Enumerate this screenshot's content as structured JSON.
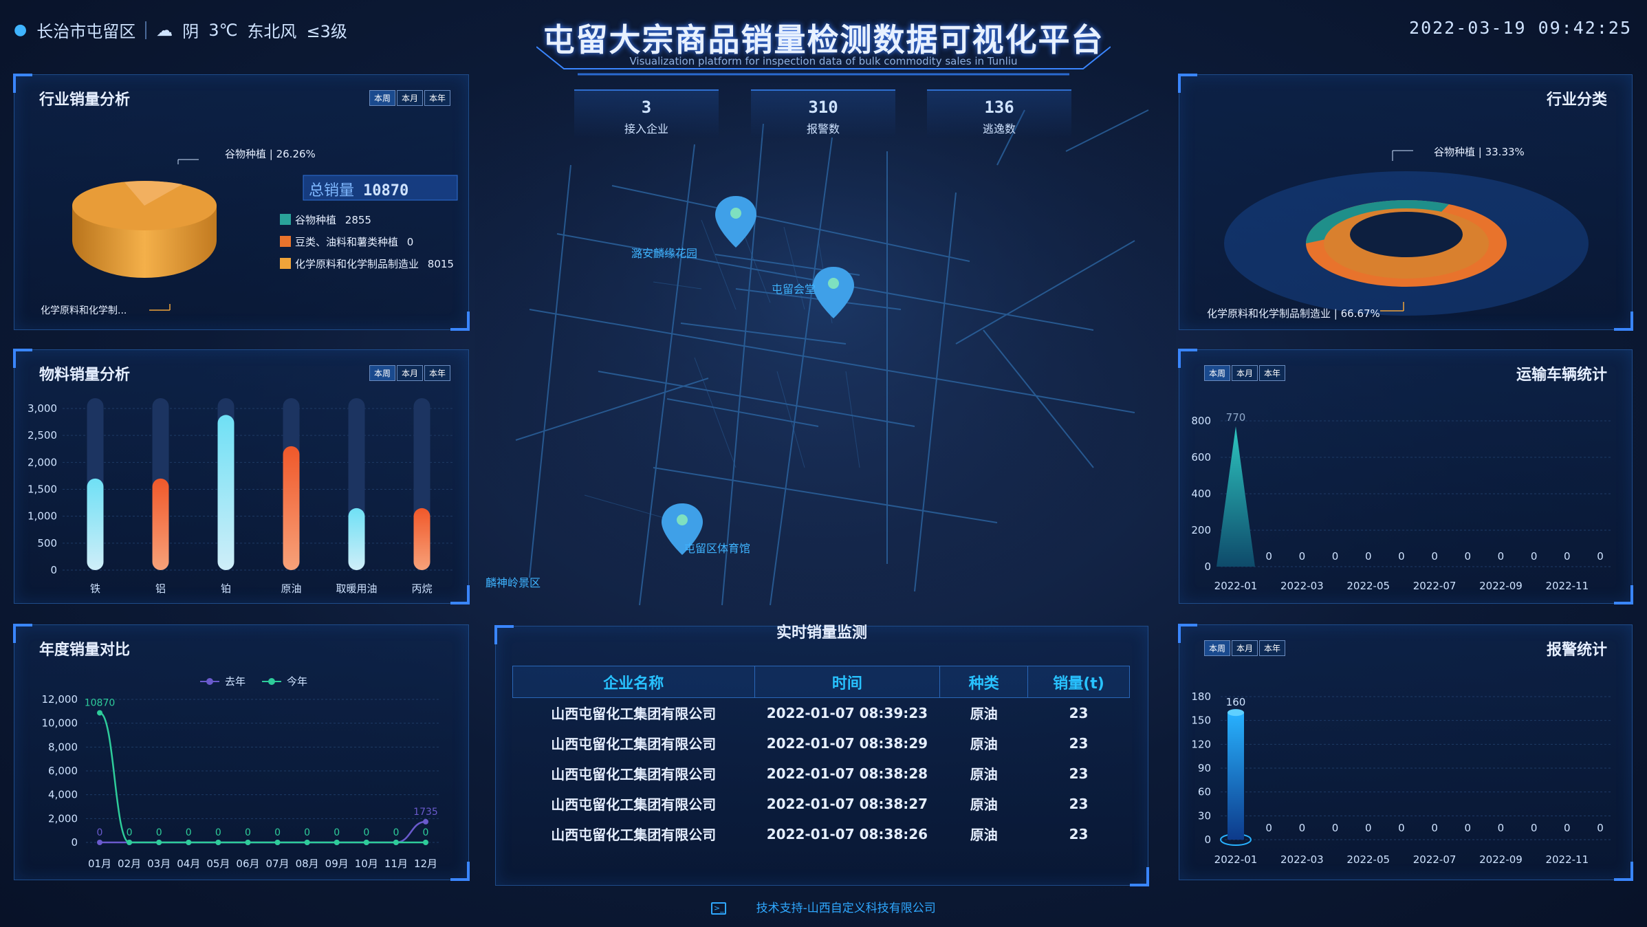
{
  "header": {
    "location": "长治市屯留区",
    "weather": "阴",
    "temperature": "3℃",
    "wind": "东北风",
    "wind_level": "≤3级",
    "title": "屯留大宗商品销量检测数据可视化平台",
    "subtitle": "Visualization platform for inspection data of bulk commodity sales in Tunliu",
    "datetime": "2022-03-19 09:42:25"
  },
  "tabs": [
    "本周",
    "本月",
    "本年"
  ],
  "stats": [
    {
      "value": "3",
      "label": "接入企业"
    },
    {
      "value": "310",
      "label": "报警数"
    },
    {
      "value": "136",
      "label": "逃逸数"
    }
  ],
  "map": {
    "places": [
      "潞安麟缘花园",
      "屯留会堂",
      "屯留区体育馆",
      "麟神岭景区"
    ]
  },
  "industry_sales": {
    "title": "行业销量分析",
    "total_label": "总销量",
    "total_value": "10870",
    "top_label": "谷物种植 | 26.26%",
    "bottom_label": "化学原料和化学制...",
    "legend": [
      {
        "name": "谷物种植",
        "value": "2855",
        "color": "#2aa39a"
      },
      {
        "name": "豆类、油料和薯类种植",
        "value": "0",
        "color": "#e8732c"
      },
      {
        "name": "化学原料和化学制品制造业",
        "value": "8015",
        "color": "#f0a43a"
      }
    ]
  },
  "industry_class": {
    "title": "行业分类",
    "top_label": "谷物种植 | 33.33%",
    "bottom_label": "化学原料和化学制品制造业 | 66.67%"
  },
  "material": {
    "title": "物料销量分析"
  },
  "transport": {
    "title": "运输车辆统计"
  },
  "annual": {
    "title": "年度销量对比"
  },
  "alarm": {
    "title": "报警统计"
  },
  "monitor": {
    "title": "实时销量监测",
    "columns": [
      "企业名称",
      "时间",
      "种类",
      "销量(t)"
    ],
    "rows": [
      [
        "山西屯留化工集团有限公司",
        "2022-01-07 08:39:23",
        "原油",
        "23"
      ],
      [
        "山西屯留化工集团有限公司",
        "2022-01-07 08:38:29",
        "原油",
        "23"
      ],
      [
        "山西屯留化工集团有限公司",
        "2022-01-07 08:38:28",
        "原油",
        "23"
      ],
      [
        "山西屯留化工集团有限公司",
        "2022-01-07 08:38:27",
        "原油",
        "23"
      ],
      [
        "山西屯留化工集团有限公司",
        "2022-01-07 08:38:26",
        "原油",
        "23"
      ]
    ]
  },
  "footer": {
    "text": "技术支持-山西自定义科技有限公司"
  },
  "chart_data": [
    {
      "type": "bar",
      "categories": [
        "铁",
        "铝",
        "铂",
        "原油",
        "取暖用油",
        "丙烷"
      ],
      "values": [
        1700,
        1700,
        2880,
        2300,
        1150,
        1150
      ],
      "ylim": [
        0,
        3000
      ],
      "yticks": [
        "0",
        "500",
        "1,000",
        "1,500",
        "2,000",
        "2,500",
        "3,000"
      ],
      "colors": [
        "#5fd4f0",
        "#f0663a",
        "#5fd4f0",
        "#f0663a",
        "#5fd4f0",
        "#f0663a"
      ]
    },
    {
      "type": "line",
      "categories": [
        "01月",
        "02月",
        "03月",
        "04月",
        "05月",
        "06月",
        "07月",
        "08月",
        "09月",
        "10月",
        "11月",
        "12月"
      ],
      "series": [
        {
          "name": "去年",
          "values": [
            0,
            0,
            0,
            0,
            0,
            0,
            0,
            0,
            0,
            0,
            0,
            1735
          ],
          "color": "#6a5acd",
          "labels": [
            "0",
            "",
            "",
            "",
            "",
            "",
            "",
            "",
            "",
            "",
            "",
            "1735"
          ]
        },
        {
          "name": "今年",
          "values": [
            10870,
            0,
            0,
            0,
            0,
            0,
            0,
            0,
            0,
            0,
            0,
            0
          ],
          "color": "#2ecc9a",
          "labels": [
            "10870",
            "0",
            "0",
            "0",
            "0",
            "0",
            "0",
            "0",
            "0",
            "0",
            "0",
            "0"
          ]
        }
      ],
      "ylim": [
        0,
        12000
      ],
      "yticks": [
        "0",
        "2,000",
        "4,000",
        "6,000",
        "8,000",
        "10,000",
        "12,000"
      ]
    },
    {
      "type": "area",
      "categories": [
        "2022-01",
        "2022-02",
        "2022-03",
        "2022-04",
        "2022-05",
        "2022-06",
        "2022-07",
        "2022-08",
        "2022-09",
        "2022-10",
        "2022-11",
        "2022-12"
      ],
      "tick_labels": [
        "2022-01",
        "2022-03",
        "2022-05",
        "2022-07",
        "2022-09",
        "2022-11"
      ],
      "values": [
        770,
        0,
        0,
        0,
        0,
        0,
        0,
        0,
        0,
        0,
        0,
        0
      ],
      "labels": [
        "770",
        "0",
        "0",
        "0",
        "0",
        "0",
        "0",
        "0",
        "0",
        "0",
        "0",
        "0"
      ],
      "ylim": [
        0,
        800
      ],
      "yticks": [
        "0",
        "200",
        "400",
        "600",
        "800"
      ]
    },
    {
      "type": "bar",
      "categories": [
        "2022-01",
        "2022-02",
        "2022-03",
        "2022-04",
        "2022-05",
        "2022-06",
        "2022-07",
        "2022-08",
        "2022-09",
        "2022-10",
        "2022-11",
        "2022-12"
      ],
      "tick_labels": [
        "2022-01",
        "2022-03",
        "2022-05",
        "2022-07",
        "2022-09",
        "2022-11"
      ],
      "values": [
        160,
        0,
        0,
        0,
        0,
        0,
        0,
        0,
        0,
        0,
        0,
        0
      ],
      "labels": [
        "160",
        "0",
        "0",
        "0",
        "0",
        "0",
        "0",
        "0",
        "0",
        "0",
        "0",
        "0"
      ],
      "ylim": [
        0,
        180
      ],
      "yticks": [
        "0",
        "30",
        "60",
        "90",
        "120",
        "150",
        "180"
      ]
    },
    {
      "type": "pie",
      "labels": [
        "谷物种植",
        "豆类、油料和薯类种植",
        "化学原料和化学制品制造业"
      ],
      "values": [
        2855,
        0,
        8015
      ]
    },
    {
      "type": "pie",
      "labels": [
        "谷物种植",
        "化学原料和化学制品制造业"
      ],
      "values": [
        33.33,
        66.67
      ]
    }
  ]
}
